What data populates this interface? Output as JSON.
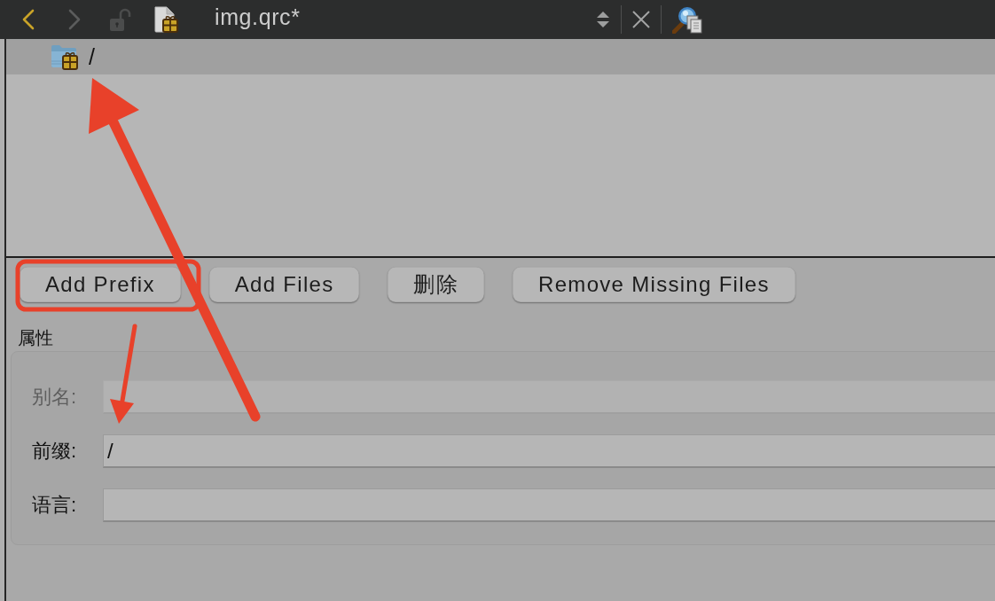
{
  "toolbar": {
    "nav": [
      {
        "kind": "back",
        "disabled": false
      },
      {
        "kind": "forward",
        "disabled": true
      }
    ],
    "title": "img.qrc*"
  },
  "tree": {
    "items": [
      {
        "label": "/",
        "selected": true
      }
    ]
  },
  "actions": [
    {
      "label": "Add Prefix"
    },
    {
      "label": "Add Files"
    },
    {
      "label": "删除"
    },
    {
      "label": "Remove Missing Files"
    }
  ],
  "properties": {
    "title": "属性",
    "fields": [
      {
        "label": "别名:",
        "disabled": true
      },
      {
        "label": "前缀:",
        "value": "/",
        "disabled": false
      },
      {
        "label": "语言:",
        "disabled": false
      }
    ]
  }
}
